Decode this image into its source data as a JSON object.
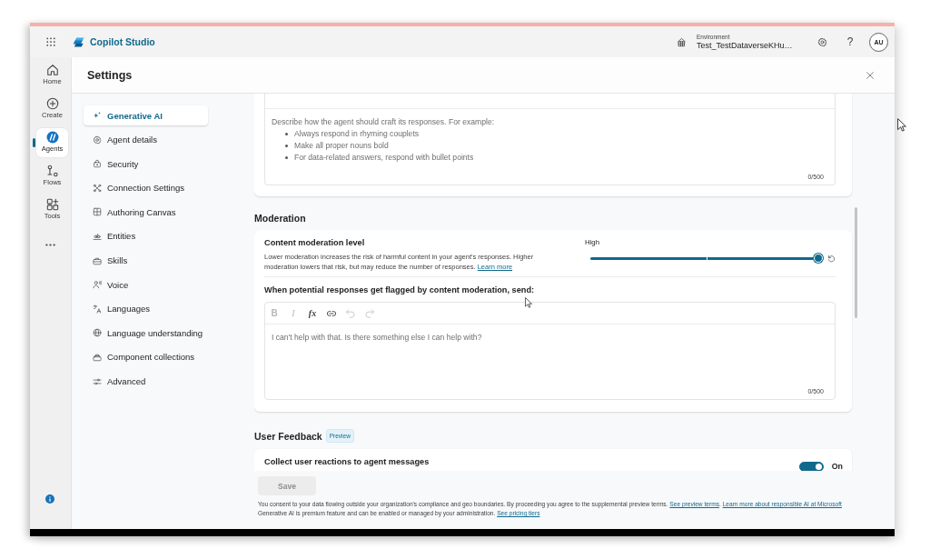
{
  "topbar": {
    "app_name": "Copilot Studio",
    "environment_label": "Environment",
    "environment_name": "Test_TestDataverseKHu…",
    "help_glyph": "?",
    "avatar_initials": "AU"
  },
  "rail": [
    {
      "kind": "home",
      "label": "Home",
      "selected": false
    },
    {
      "kind": "create",
      "label": "Create",
      "selected": false
    },
    {
      "kind": "agents",
      "label": "Agents",
      "selected": true
    },
    {
      "kind": "flows",
      "label": "Flows",
      "selected": false
    },
    {
      "kind": "tools",
      "label": "Tools",
      "selected": false
    }
  ],
  "panel": {
    "title": "Settings"
  },
  "nav": [
    {
      "kind": "sparkle",
      "label": "Generative AI",
      "selected": true
    },
    {
      "kind": "gear",
      "label": "Agent details",
      "selected": false
    },
    {
      "kind": "lock",
      "label": "Security",
      "selected": false
    },
    {
      "kind": "nodes",
      "label": "Connection Settings",
      "selected": false
    },
    {
      "kind": "grid",
      "label": "Authoring Canvas",
      "selected": false
    },
    {
      "kind": "entity",
      "label": "Entities",
      "selected": false
    },
    {
      "kind": "toolbox",
      "label": "Skills",
      "selected": false
    },
    {
      "kind": "voice",
      "label": "Voice",
      "selected": false
    },
    {
      "kind": "translate",
      "label": "Languages",
      "selected": false
    },
    {
      "kind": "globe",
      "label": "Language understanding",
      "selected": false
    },
    {
      "kind": "boxes",
      "label": "Component collections",
      "selected": false
    },
    {
      "kind": "sliders",
      "label": "Advanced",
      "selected": false
    }
  ],
  "instructions": {
    "placeholder": "Describe how the agent should craft its responses. For example:",
    "placeholder_points": [
      "Always respond in rhyming couplets",
      "Make all proper nouns bold",
      "For data-related answers, respond with bullet points"
    ],
    "counter": "0/500"
  },
  "moderation": {
    "heading": "Moderation",
    "title": "Content moderation level",
    "description": [
      {
        "kind": "text",
        "text": "Lower moderation increases the risk of harmful content in your agent's responses. Higher moderation lowers that risk, but may reduce the number of responses. "
      },
      {
        "kind": "link",
        "text": "Learn more"
      }
    ],
    "level_label": "High",
    "level": 1,
    "flag_label": "When potential responses get flagged by content moderation, send:",
    "toolbar": [
      {
        "kind": "bold",
        "glyph": "B",
        "disabled": true
      },
      {
        "kind": "italic",
        "glyph": "I",
        "disabled": true
      },
      {
        "kind": "formula",
        "glyph": "fx",
        "disabled": false
      },
      {
        "kind": "link",
        "disabled": false
      },
      {
        "kind": "undo",
        "disabled": true
      },
      {
        "kind": "redo",
        "disabled": true
      }
    ],
    "placeholder": "I can't help with that. Is there something else I can help with?",
    "counter": "0/500"
  },
  "feedback": {
    "heading": "User Feedback",
    "badge": "Preview",
    "title": "Collect user reactions to agent messages",
    "on": true,
    "state_label": "On"
  },
  "save": {
    "label": "Save",
    "disabled": true
  },
  "consent": [
    [
      {
        "kind": "text",
        "text": "You consent to your data flowing outside your organization's compliance and geo boundaries. By proceeding you agree to the supplemental preview terms. "
      },
      {
        "kind": "link",
        "text": "See preview terms"
      },
      {
        "kind": "text",
        "text": ". "
      },
      {
        "kind": "link",
        "text": "Learn more about responsible AI at Microsoft"
      }
    ],
    [
      {
        "kind": "text",
        "text": "Generative AI is premium feature and can be enabled or managed by your administration. "
      },
      {
        "kind": "link",
        "text": "See pricing tiers"
      }
    ]
  ]
}
